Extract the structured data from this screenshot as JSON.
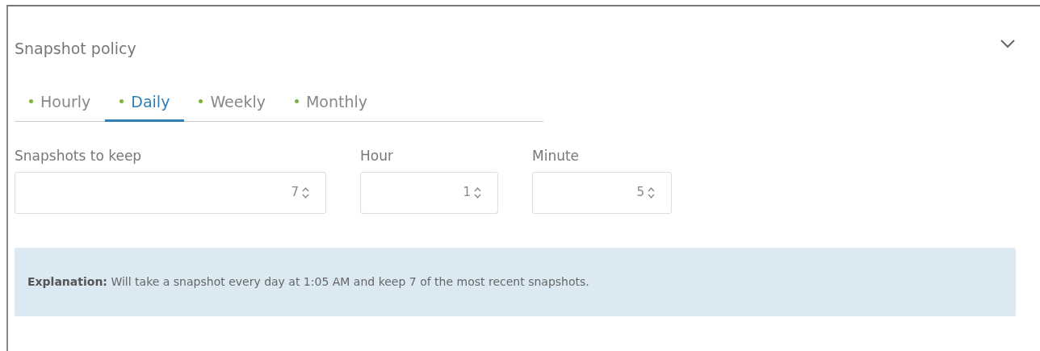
{
  "panel": {
    "title": "Snapshot policy",
    "expanded": true
  },
  "tabs": [
    {
      "label": "Hourly",
      "selected": false,
      "color": "#7cb342"
    },
    {
      "label": "Daily",
      "selected": true,
      "color": "#7cb342"
    },
    {
      "label": "Weekly",
      "selected": false,
      "color": "#7cb342"
    },
    {
      "label": "Monthly",
      "selected": false,
      "color": "#7cb342"
    }
  ],
  "fields": [
    {
      "label": "Snapshots to keep",
      "value": "7"
    },
    {
      "label": "Hour",
      "value": "1"
    },
    {
      "label": "Minute",
      "value": "5"
    }
  ],
  "explanation": "**Explanation:** Will take a snapshot every day at 1:05 AM and keep 7 of the most recent snapshots."
}
